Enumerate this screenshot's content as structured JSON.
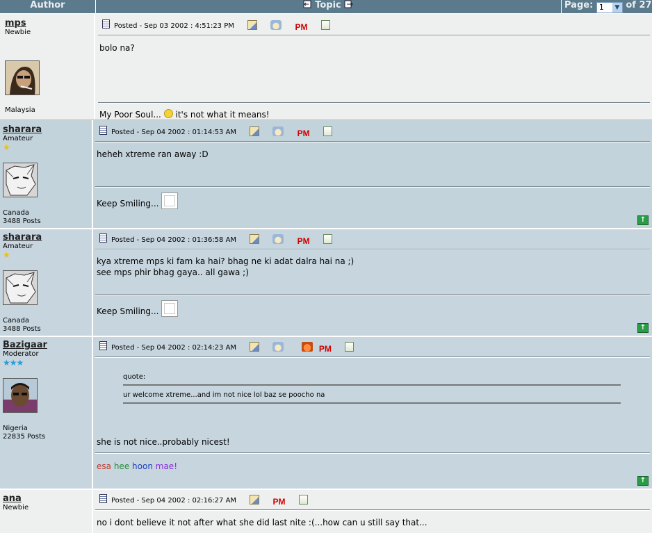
{
  "header": {
    "author_label": "Author",
    "topic_label": "Topic",
    "page_label": "Page:",
    "page_value": "1",
    "page_total": "of 27"
  },
  "colors": {
    "header_bg": "#5b7a8c",
    "row_light": "#eef0f0",
    "row_blue": "#c3d3dc",
    "pm": "#d10000",
    "star": "#e3c21a"
  },
  "posts": [
    {
      "user": "mps",
      "rank": "Newbie",
      "country": "Malaysia",
      "posts": "",
      "posted": "Posted - Sep 03 2002 :  4:51:23 PM",
      "body": [
        "bolo na?"
      ],
      "signature": "My Poor Soul... ",
      "signature_tail": " it's not what it means!",
      "pm_label": "PM"
    },
    {
      "user": "sharara",
      "rank": "Amateur",
      "country": "Canada",
      "posts": "3488 Posts",
      "posted": "Posted - Sep 04 2002 :  01:14:53 AM",
      "body": [
        "heheh xtreme ran away :D"
      ],
      "signature": "Keep Smiling...",
      "pm_label": "PM",
      "stars": "★"
    },
    {
      "user": "sharara",
      "rank": "Amateur",
      "country": "Canada",
      "posts": "3488 Posts",
      "posted": "Posted - Sep 04 2002 :  01:36:58 AM",
      "body": [
        "kya xtreme mps ki fam ka hai? bhag ne ki adat dalra hai na ;)",
        "see mps phir bhag gaya.. all gawa ;)"
      ],
      "signature": "Keep Smiling...",
      "pm_label": "PM",
      "stars": "★"
    },
    {
      "user": "Bazigaar",
      "rank": "Moderator",
      "country": "Nigeria",
      "posts": "22835 Posts",
      "posted": "Posted - Sep 04 2002 :  02:14:23 AM",
      "quote_label": "quote:",
      "quote_text": "ur welcome xtreme...and im not nice lol baz se poocho na",
      "body": [
        "she is not nice..probably nicest!"
      ],
      "signature_words": [
        "esa",
        "hee",
        "hoon",
        "mae!"
      ],
      "pm_label": "PM",
      "stars": "★★★"
    },
    {
      "user": "ana",
      "rank": "Newbie",
      "country": "",
      "posts": "",
      "posted": "Posted - Sep 04 2002 :  02:16:27 AM",
      "body": [
        "no i dont believe it not after what she did last nite :(...how can u still say that..."
      ],
      "pm_label": "PM"
    }
  ],
  "icons": {
    "doc": "document-icon",
    "edit": "edit-profile-icon",
    "mail": "email-icon",
    "home": "homepage-icon",
    "reply": "reply-with-quote-icon",
    "top": "go-to-top-icon"
  }
}
